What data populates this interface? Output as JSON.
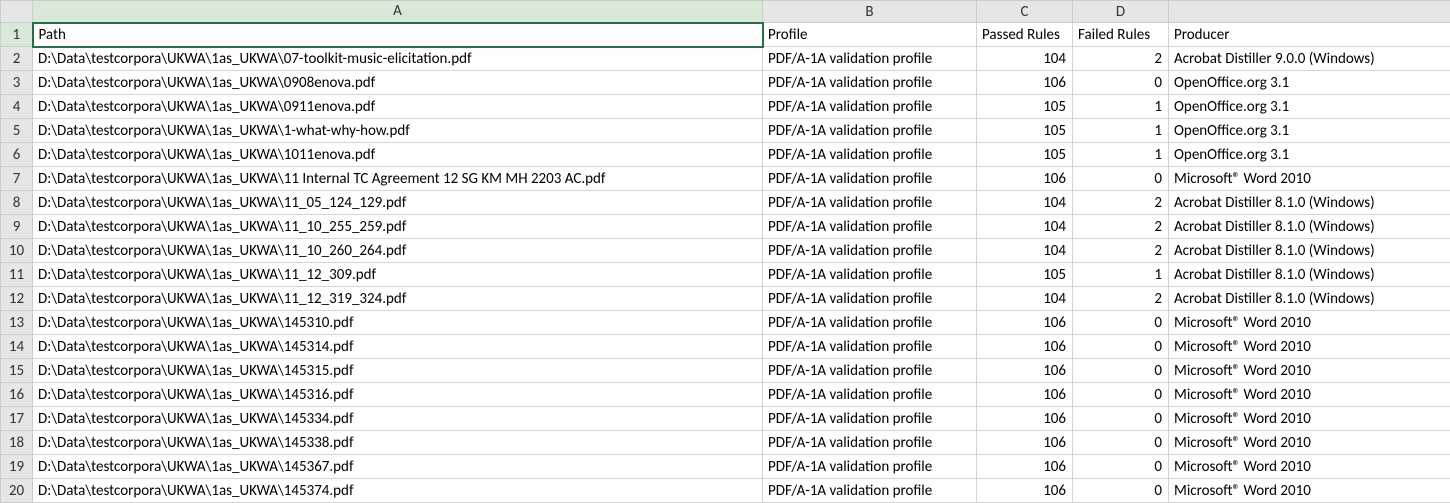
{
  "columns": [
    "A",
    "B",
    "C",
    "D"
  ],
  "headers": {
    "A": "Path",
    "B": "Profile",
    "C": "Passed Rules",
    "D": "Failed Rules",
    "E": "Producer"
  },
  "active_cell": "A1",
  "rows": [
    {
      "n": 2,
      "path": "D:\\Data\\testcorpora\\UKWA\\1as_UKWA\\07-toolkit-music-elicitation.pdf",
      "profile": "PDF/A-1A validation profile",
      "passed": 104,
      "failed": 2,
      "producer": "Acrobat Distiller 9.0.0 (Windows)"
    },
    {
      "n": 3,
      "path": "D:\\Data\\testcorpora\\UKWA\\1as_UKWA\\0908enova.pdf",
      "profile": "PDF/A-1A validation profile",
      "passed": 106,
      "failed": 0,
      "producer": "OpenOffice.org 3.1"
    },
    {
      "n": 4,
      "path": "D:\\Data\\testcorpora\\UKWA\\1as_UKWA\\0911enova.pdf",
      "profile": "PDF/A-1A validation profile",
      "passed": 105,
      "failed": 1,
      "producer": "OpenOffice.org 3.1"
    },
    {
      "n": 5,
      "path": "D:\\Data\\testcorpora\\UKWA\\1as_UKWA\\1-what-why-how.pdf",
      "profile": "PDF/A-1A validation profile",
      "passed": 105,
      "failed": 1,
      "producer": "OpenOffice.org 3.1"
    },
    {
      "n": 6,
      "path": "D:\\Data\\testcorpora\\UKWA\\1as_UKWA\\1011enova.pdf",
      "profile": "PDF/A-1A validation profile",
      "passed": 105,
      "failed": 1,
      "producer": "OpenOffice.org 3.1"
    },
    {
      "n": 7,
      "path": "D:\\Data\\testcorpora\\UKWA\\1as_UKWA\\11 Internal TC Agreement 12 SG KM MH 2203 AC.pdf",
      "profile": "PDF/A-1A validation profile",
      "passed": 106,
      "failed": 0,
      "producer": "Microsoft® Word 2010"
    },
    {
      "n": 8,
      "path": "D:\\Data\\testcorpora\\UKWA\\1as_UKWA\\11_05_124_129.pdf",
      "profile": "PDF/A-1A validation profile",
      "passed": 104,
      "failed": 2,
      "producer": "Acrobat Distiller 8.1.0 (Windows)"
    },
    {
      "n": 9,
      "path": "D:\\Data\\testcorpora\\UKWA\\1as_UKWA\\11_10_255_259.pdf",
      "profile": "PDF/A-1A validation profile",
      "passed": 104,
      "failed": 2,
      "producer": "Acrobat Distiller 8.1.0 (Windows)"
    },
    {
      "n": 10,
      "path": "D:\\Data\\testcorpora\\UKWA\\1as_UKWA\\11_10_260_264.pdf",
      "profile": "PDF/A-1A validation profile",
      "passed": 104,
      "failed": 2,
      "producer": "Acrobat Distiller 8.1.0 (Windows)"
    },
    {
      "n": 11,
      "path": "D:\\Data\\testcorpora\\UKWA\\1as_UKWA\\11_12_309.pdf",
      "profile": "PDF/A-1A validation profile",
      "passed": 105,
      "failed": 1,
      "producer": "Acrobat Distiller 8.1.0 (Windows)"
    },
    {
      "n": 12,
      "path": "D:\\Data\\testcorpora\\UKWA\\1as_UKWA\\11_12_319_324.pdf",
      "profile": "PDF/A-1A validation profile",
      "passed": 104,
      "failed": 2,
      "producer": "Acrobat Distiller 8.1.0 (Windows)"
    },
    {
      "n": 13,
      "path": "D:\\Data\\testcorpora\\UKWA\\1as_UKWA\\145310.pdf",
      "profile": "PDF/A-1A validation profile",
      "passed": 106,
      "failed": 0,
      "producer": "Microsoft® Word 2010"
    },
    {
      "n": 14,
      "path": "D:\\Data\\testcorpora\\UKWA\\1as_UKWA\\145314.pdf",
      "profile": "PDF/A-1A validation profile",
      "passed": 106,
      "failed": 0,
      "producer": "Microsoft® Word 2010"
    },
    {
      "n": 15,
      "path": "D:\\Data\\testcorpora\\UKWA\\1as_UKWA\\145315.pdf",
      "profile": "PDF/A-1A validation profile",
      "passed": 106,
      "failed": 0,
      "producer": "Microsoft® Word 2010"
    },
    {
      "n": 16,
      "path": "D:\\Data\\testcorpora\\UKWA\\1as_UKWA\\145316.pdf",
      "profile": "PDF/A-1A validation profile",
      "passed": 106,
      "failed": 0,
      "producer": "Microsoft® Word 2010"
    },
    {
      "n": 17,
      "path": "D:\\Data\\testcorpora\\UKWA\\1as_UKWA\\145334.pdf",
      "profile": "PDF/A-1A validation profile",
      "passed": 106,
      "failed": 0,
      "producer": "Microsoft® Word 2010"
    },
    {
      "n": 18,
      "path": "D:\\Data\\testcorpora\\UKWA\\1as_UKWA\\145338.pdf",
      "profile": "PDF/A-1A validation profile",
      "passed": 106,
      "failed": 0,
      "producer": "Microsoft® Word 2010"
    },
    {
      "n": 19,
      "path": "D:\\Data\\testcorpora\\UKWA\\1as_UKWA\\145367.pdf",
      "profile": "PDF/A-1A validation profile",
      "passed": 106,
      "failed": 0,
      "producer": "Microsoft® Word 2010"
    },
    {
      "n": 20,
      "path": "D:\\Data\\testcorpora\\UKWA\\1as_UKWA\\145374.pdf",
      "profile": "PDF/A-1A validation profile",
      "passed": 106,
      "failed": 0,
      "producer": "Microsoft® Word 2010"
    }
  ]
}
